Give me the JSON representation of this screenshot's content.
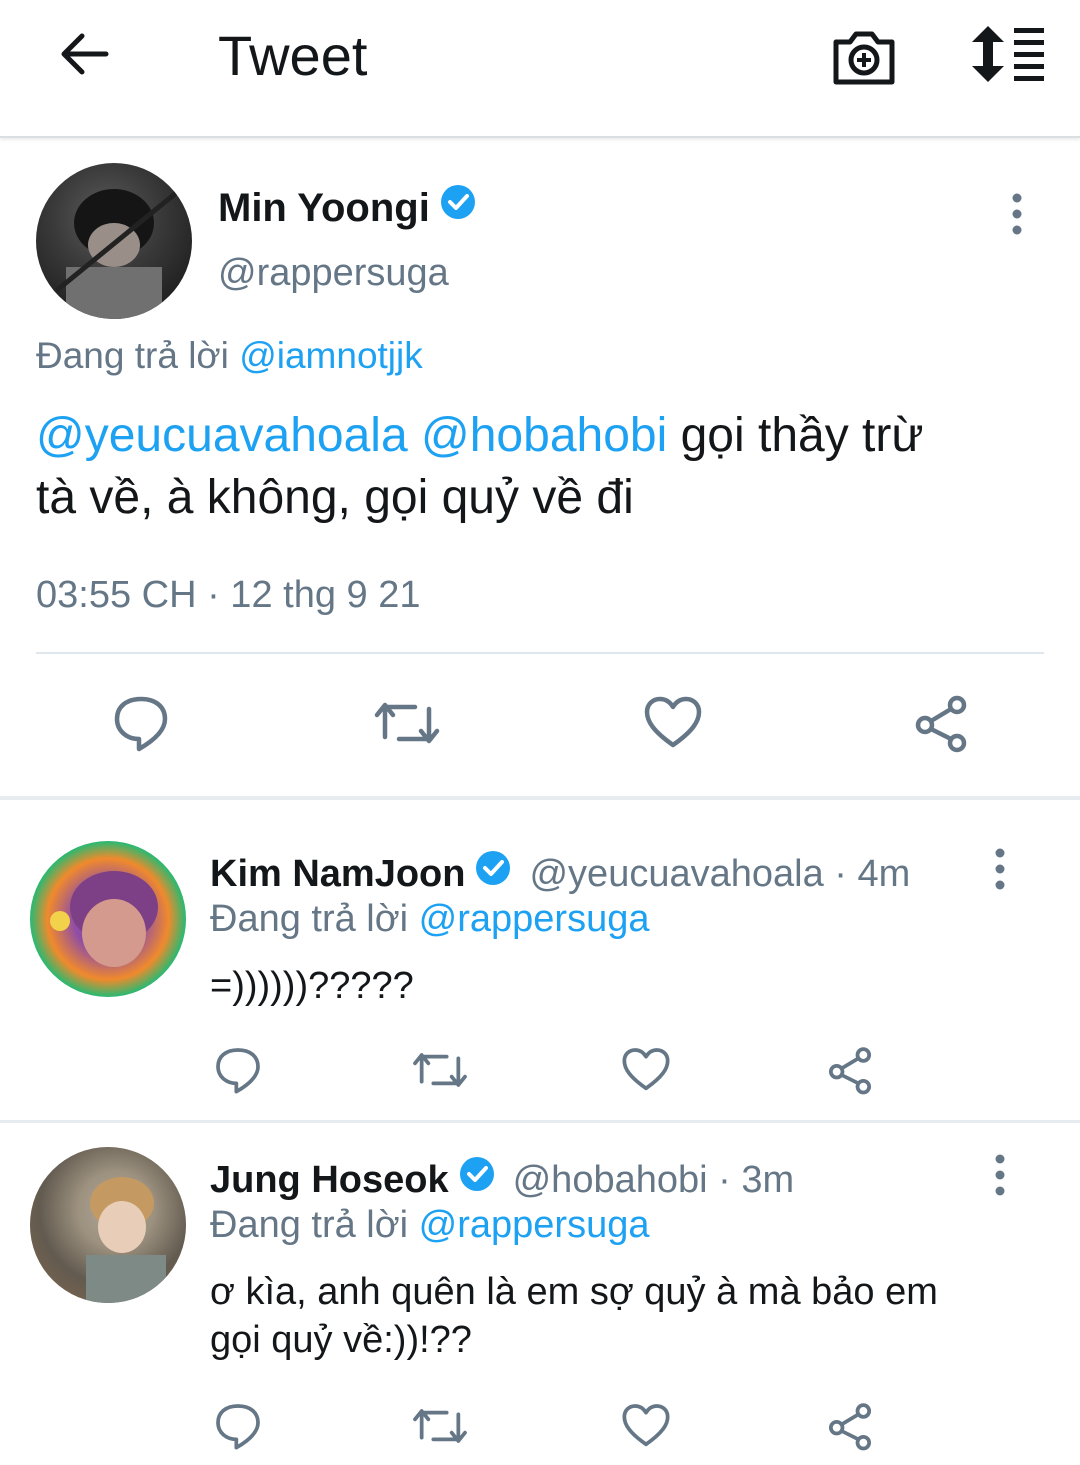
{
  "topbar": {
    "title": "Tweet"
  },
  "main_tweet": {
    "name": "Min Yoongi",
    "handle": "@rappersuga",
    "replying_label": "Đang trả lời",
    "replying_to": "@iamnotjjk",
    "mention1": "@yeucuavahoala",
    "mention2": "@hobahobi",
    "text_line1": " gọi thầy trừ",
    "text_line2": "tà về, à không, gọi quỷ về  đi",
    "time": "03:55 CH · 12 thg 9 21"
  },
  "replies": [
    {
      "name": "Kim NamJoon",
      "handle": "@yeucuavahoala · 4m",
      "replying_label": "Đang trả lời",
      "replying_to": "@rappersuga",
      "text": "=))))))?????"
    },
    {
      "name": "Jung Hoseok",
      "handle": "@hobahobi · 3m",
      "replying_label": "Đang trả lời",
      "replying_to": "@rappersuga",
      "text_line1": "ơ kìa, anh quên là em sợ quỷ à mà bảo em",
      "text_line2": "gọi quỷ về:))!??"
    }
  ],
  "colors": {
    "link": "#1da1f2",
    "muted": "#657786",
    "text": "#14171a",
    "divider": "#e6ecf0"
  }
}
